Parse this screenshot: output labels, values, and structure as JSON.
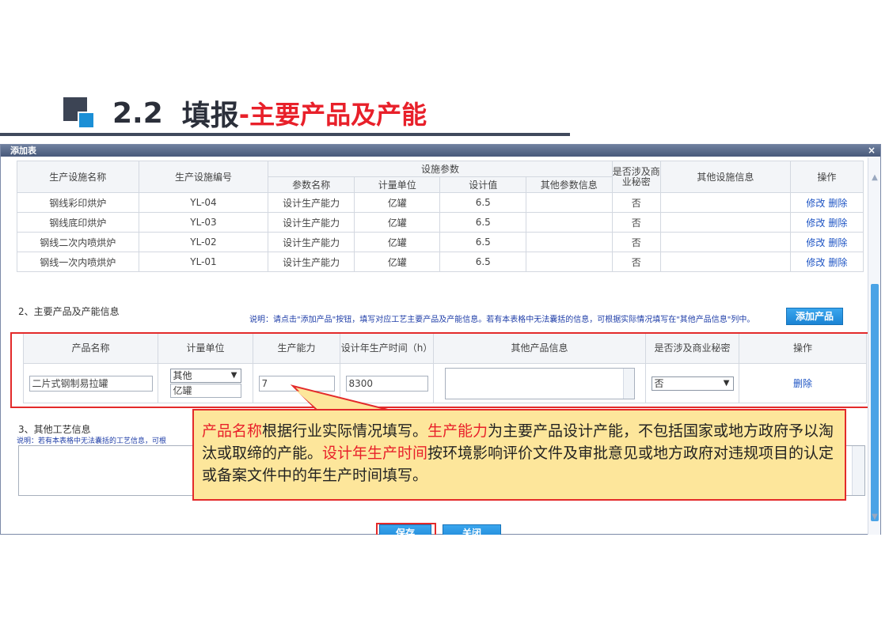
{
  "slide": {
    "title_num": "2.2",
    "title_main": "填报",
    "title_sub": "-主要产品及产能"
  },
  "dialog": {
    "title": "添加表",
    "close": "×"
  },
  "facility_table": {
    "headers": {
      "name": "生产设施名称",
      "code": "生产设施编号",
      "params_group": "设施参数",
      "param_name": "参数名称",
      "unit": "计量单位",
      "design_value": "设计值",
      "other_param": "其他参数信息",
      "secret": "是否涉及商业秘密",
      "other_info": "其他设施信息",
      "ops": "操作"
    },
    "rows": [
      {
        "name": "钢线彩印烘炉",
        "code": "YL-04",
        "param": "设计生产能力",
        "unit": "亿罐",
        "value": "6.5",
        "secret": "否",
        "edit": "修改",
        "del": "删除"
      },
      {
        "name": "钢线底印烘炉",
        "code": "YL-03",
        "param": "设计生产能力",
        "unit": "亿罐",
        "value": "6.5",
        "secret": "否",
        "edit": "修改",
        "del": "删除"
      },
      {
        "name": "钢线二次内喷烘炉",
        "code": "YL-02",
        "param": "设计生产能力",
        "unit": "亿罐",
        "value": "6.5",
        "secret": "否",
        "edit": "修改",
        "del": "删除"
      },
      {
        "name": "钢线一次内喷烘炉",
        "code": "YL-01",
        "param": "设计生产能力",
        "unit": "亿罐",
        "value": "6.5",
        "secret": "否",
        "edit": "修改",
        "del": "删除"
      }
    ]
  },
  "section2": {
    "label": "2、主要产品及产能信息",
    "note": "说明：请点击\"添加产品\"按钮，填写对应工艺主要产品及产能信息。若有本表格中无法囊括的信息，可根据实际情况填写在\"其他产品信息\"列中。",
    "add_button": "添加产品"
  },
  "product_table": {
    "headers": {
      "name": "产品名称",
      "unit": "计量单位",
      "capacity": "生产能力",
      "hours": "设计年生产时间（h）",
      "other": "其他产品信息",
      "secret": "是否涉及商业秘密",
      "ops": "操作"
    },
    "row": {
      "name": "二片式钢制易拉罐",
      "unit_select": "其他",
      "unit_text": "亿罐",
      "capacity": "7",
      "hours": "8300",
      "secret": "否",
      "delete": "删除"
    }
  },
  "section3": {
    "label": "3、其他工艺信息",
    "note": "说明：若有本表格中无法囊括的工艺信息，可根"
  },
  "buttons": {
    "save": "保存",
    "close": "关闭"
  },
  "callout": {
    "hl1": "产品名称",
    "t1": "根据行业实际情况填写。",
    "hl2": "生产能力",
    "t2": "为主要产品设计产能，不包括国家或地方政府予以淘汰或取缔的产能。",
    "hl3": "设计年生产时间",
    "t3": "按环境影响评价文件及审批意见或地方政府对违规项目的认定或备案文件中的年生产时间填写。"
  },
  "colors": {
    "accent_red": "#e8202a",
    "link_blue": "#1f55c4",
    "button_blue": "#1b84d4",
    "callout_bg": "#fde69b"
  }
}
